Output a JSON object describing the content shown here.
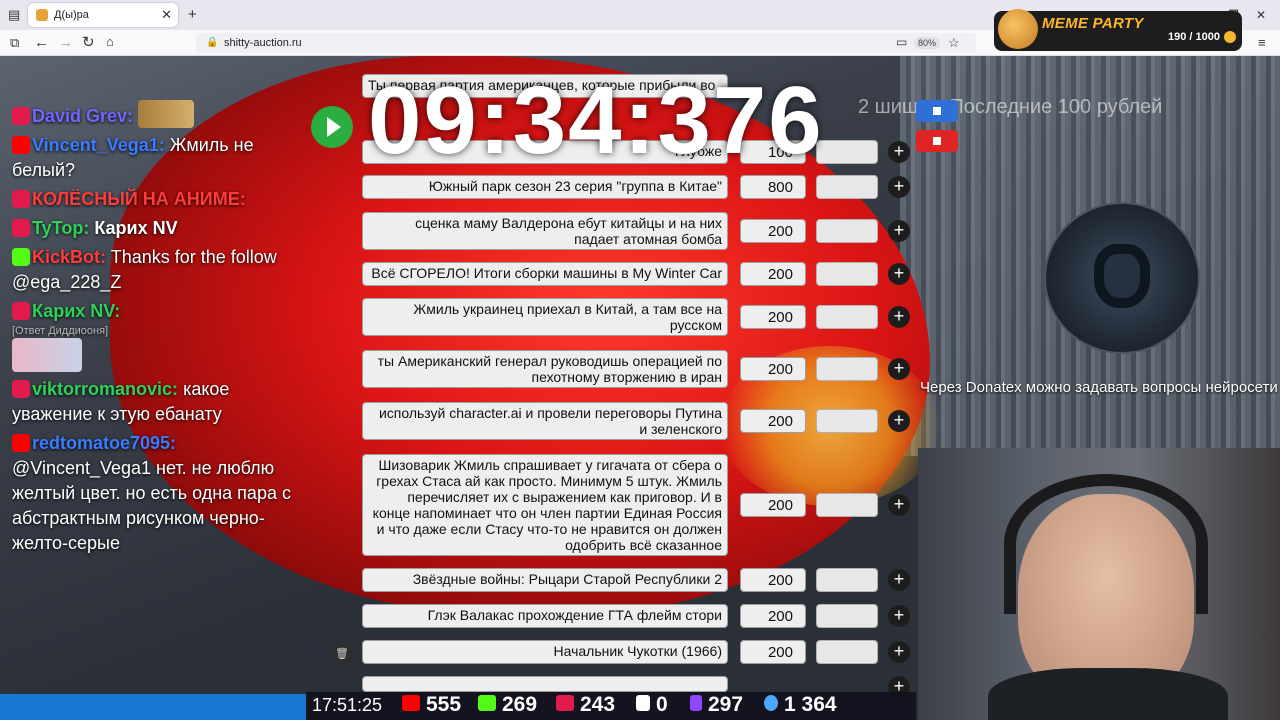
{
  "browser": {
    "tab_title": "Д(ы)ра",
    "url": "shitty-auction.ru",
    "zoom": "80%"
  },
  "meme_party": {
    "title": "MEME PARTY",
    "counter": "190 / 1000"
  },
  "timer": "09:34:376",
  "background_text": "2 шишка: Последние 100 рублей",
  "chat": [
    {
      "user": "David Grev:",
      "text": ""
    },
    {
      "user": "Vincent_Vega1:",
      "text": "Жмиль не белый?"
    },
    {
      "user": "КОЛЁСНЫЙ НА АНИМЕ:",
      "text": ""
    },
    {
      "user": "TyTop:",
      "text": "Карих NV"
    },
    {
      "user": "KickBot:",
      "text": "Thanks for the follow @ega_228_Z"
    },
    {
      "user": "Карих NV:",
      "text": "",
      "sub": "[Ответ Диддиооня]"
    },
    {
      "user": "viktorromanovic:",
      "text": "какое уважение к этую ебанату"
    },
    {
      "user": "redtomatoe7095:",
      "text": "@Vincent_Vega1 нет. не люблю желтый цвет. но есть одна пара с абстрактным рисунком черно-желто-серые"
    }
  ],
  "lots": [
    {
      "title": "Ты первая партия американцев, которые прибыли во",
      "amount": ""
    },
    {
      "title": "Глубже",
      "amount": "100"
    },
    {
      "title": "Южный парк сезон 23 серия \"группа в Китае\"",
      "amount": "800"
    },
    {
      "title": "сценка маму Валдерона ебут китайцы и на них падает атомная бомба",
      "amount": "200"
    },
    {
      "title": "Всё СГОРЕЛО! Итоги сборки машины в My Winter Car",
      "amount": "200"
    },
    {
      "title": "Жмиль украинец приехал в Китай, а там все на русском",
      "amount": "200"
    },
    {
      "title": "ты Американский генерал руководишь операцией по пехотному вторжению в иран",
      "amount": "200"
    },
    {
      "title": "используй character.ai и провели переговоры Путина и зеленского",
      "amount": "200"
    },
    {
      "title": "Шизоварик Жмиль спрашивает у гигачата от сбера о грехах Стаса ай как просто. Минимум 5 штук. Жмиль перечисляет их с выражением как приговор. И в конце напоминает что он член партии Единая Россия и что даже если Стасу что-то не нравится он должен одобрить всё сказанное",
      "amount": "200"
    },
    {
      "title": "Звёздные войны: Рыцари Старой Республики 2",
      "amount": "200"
    },
    {
      "title": "Глэк Валакас прохождение ГТА флейм стори",
      "amount": "200"
    },
    {
      "title": "Начальник Чукотки (1966)",
      "amount": "200"
    }
  ],
  "donatex_text": "Через Donatex можно задавать вопросы нейросети",
  "stats": {
    "time": "17:51:25",
    "youtube": "555",
    "kick": "269",
    "live": "243",
    "r": "0",
    "twitch": "297",
    "total": "1 364"
  },
  "colors": {
    "play": "#2aae3f",
    "youtube": "#ff0000",
    "kick": "#53fc18",
    "live": "#e21b4f"
  }
}
